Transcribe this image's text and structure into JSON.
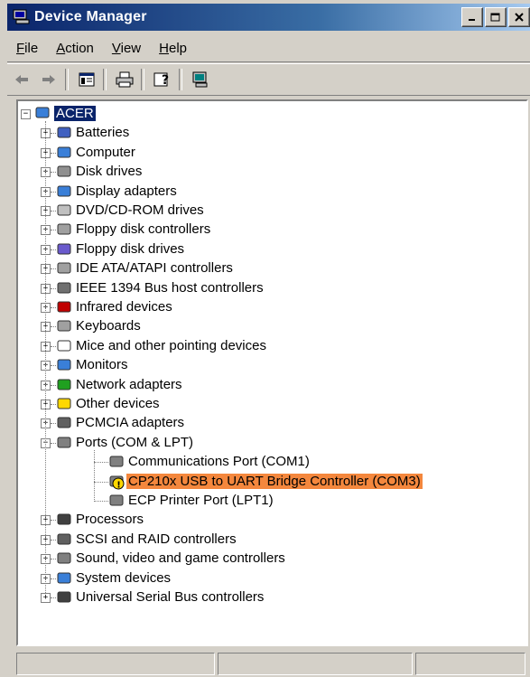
{
  "window": {
    "title": "Device Manager"
  },
  "menu": [
    {
      "label": "File",
      "accel": "F"
    },
    {
      "label": "Action",
      "accel": "A"
    },
    {
      "label": "View",
      "accel": "V"
    },
    {
      "label": "Help",
      "accel": "H"
    }
  ],
  "tree": {
    "root": "ACER",
    "categories": [
      "Batteries",
      "Computer",
      "Disk drives",
      "Display adapters",
      "DVD/CD-ROM drives",
      "Floppy disk controllers",
      "Floppy disk drives",
      "IDE ATA/ATAPI controllers",
      "IEEE 1394 Bus host controllers",
      "Infrared devices",
      "Keyboards",
      "Mice and other pointing devices",
      "Monitors",
      "Network adapters",
      "Other devices",
      "PCMCIA adapters",
      "Ports (COM & LPT)",
      "Processors",
      "SCSI and RAID controllers",
      "Sound, video and game controllers",
      "System devices",
      "Universal Serial Bus controllers"
    ],
    "ports_children": [
      "Communications Port (COM1)",
      "CP210x USB to UART Bridge Controller (COM3)",
      "ECP Printer Port (LPT1)"
    ]
  },
  "colors": {
    "title_gradient_start": "#0a246a",
    "highlight": "#f4873d",
    "warning": "#ffd800"
  }
}
